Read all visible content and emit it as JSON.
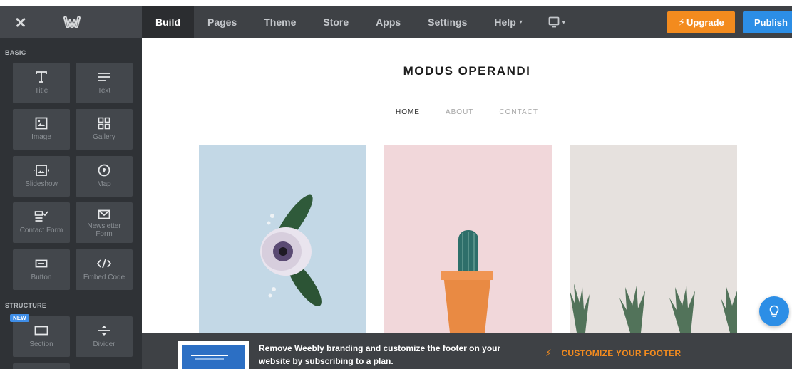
{
  "toolbar": {
    "nav": [
      {
        "label": "Build",
        "active": true
      },
      {
        "label": "Pages"
      },
      {
        "label": "Theme"
      },
      {
        "label": "Store"
      },
      {
        "label": "Apps"
      },
      {
        "label": "Settings"
      },
      {
        "label": "Help",
        "caret": "▾"
      }
    ],
    "device_caret": "▾",
    "upgrade_label": "Upgrade",
    "upgrade_icon": "⚡",
    "publish_label": "Publish"
  },
  "sidebar": {
    "basic_heading": "BASIC",
    "structure_heading": "STRUCTURE",
    "new_badge": "NEW",
    "tiles": [
      {
        "label": "Title",
        "icon": "title-icon"
      },
      {
        "label": "Text",
        "icon": "text-icon"
      },
      {
        "label": "Image",
        "icon": "image-icon"
      },
      {
        "label": "Gallery",
        "icon": "gallery-icon"
      },
      {
        "label": "Slideshow",
        "icon": "slideshow-icon"
      },
      {
        "label": "Map",
        "icon": "map-pin-icon"
      },
      {
        "label": "Contact Form",
        "icon": "contact-form-icon"
      },
      {
        "label": "Newsletter Form",
        "icon": "envelope-icon"
      },
      {
        "label": "Button",
        "icon": "button-icon"
      },
      {
        "label": "Embed Code",
        "icon": "code-icon"
      },
      {
        "label": "Section",
        "icon": "section-icon"
      },
      {
        "label": "Divider",
        "icon": "divider-icon"
      }
    ]
  },
  "site": {
    "title": "MODUS OPERANDI",
    "nav": [
      "HOME",
      "ABOUT",
      "CONTACT"
    ]
  },
  "footer": {
    "promo_text": "Remove Weebly branding and customize the footer on your website by subscribing to a plan.",
    "promo_link": "CUSTOMIZE YOUR FOOTER",
    "promo_icon": "⚡"
  },
  "colors": {
    "accent_orange": "#f38b1e",
    "accent_blue": "#2c8ee6",
    "toolbar_bg": "#3e4145",
    "sidebar_bg": "#2f3236",
    "tile_bg": "#43474c"
  }
}
